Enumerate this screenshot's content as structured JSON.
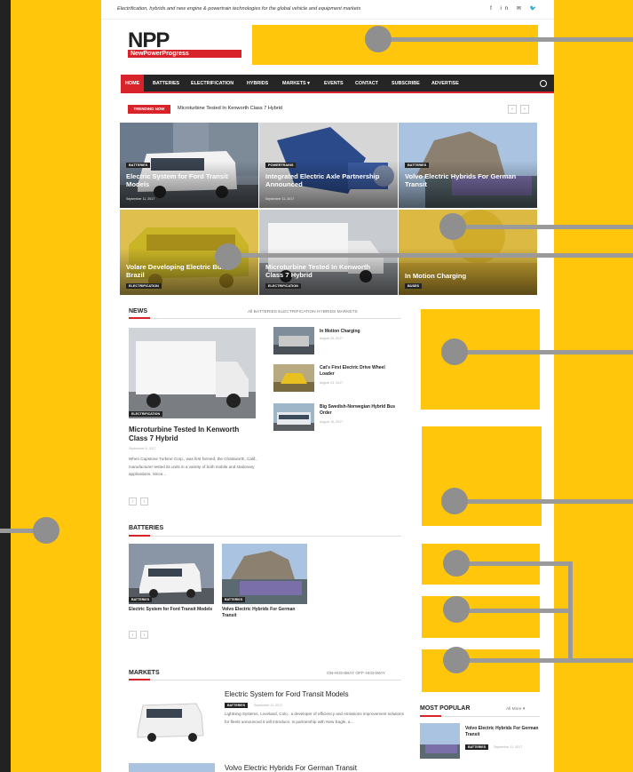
{
  "header": {
    "tagline": "Electrification, hybrids and new engine & powertrain technologies for the global vehicle and equipment markets",
    "social_icons": [
      "f",
      "in",
      "✉",
      "🐦"
    ],
    "logo_text": "NPP",
    "logo_subtext": "NewPowerProgress"
  },
  "nav": {
    "items": [
      "HOME",
      "BATTERIES",
      "ELECTRIFICATION",
      "HYBRIDS",
      "MARKETS ▾",
      "EVENTS",
      "CONTACT",
      "SUBSCRIBE",
      "ADVERTISE"
    ]
  },
  "trending": {
    "label": "TRENDING NOW",
    "text": "Microturbine Tested In Kenworth Class 7 Hybrid"
  },
  "featured": [
    {
      "category": "BATTERIES",
      "title": "Electric System for Ford Transit Models",
      "date": "September 11, 2017"
    },
    {
      "category": "POWERTRAINS",
      "title": "Integrated Electric Axle Partnership Announced",
      "date": "September 11, 2017"
    },
    {
      "category": "BATTERIES",
      "title": "Volvo Electric Hybrids For German Transit",
      "date": ""
    },
    {
      "category": "ELECTRIFICATION",
      "title": "Volare Developing Electric Bus In Brazil",
      "date": ""
    },
    {
      "category": "ELECTRIFICATION",
      "title": "Microturbine Tested In Kenworth Class 7 Hybrid",
      "date": ""
    },
    {
      "category": "BUSES",
      "title": "In Motion Charging",
      "date": ""
    }
  ],
  "news": {
    "title": "NEWS",
    "filters": "All    BATTERIES    ELECTRIFICATION    HYBRIDS    MARKETS",
    "main": {
      "category": "ELECTRIFICATION",
      "title": "Microturbine Tested In Kenworth Class 7 Hybrid",
      "date": "September 6, 2017",
      "excerpt": "When Capstone Turbine Corp., was first formed, the Chatsworth, Calif., manufacturer tested its units in a variety of both mobile and stationary applications. Since..."
    },
    "side_items": [
      {
        "title": "In Motion Charging",
        "date": "August 25, 2017"
      },
      {
        "title": "Cat's First Electric Drive Wheel Loader",
        "date": "August 23, 2017"
      },
      {
        "title": "Big Swedish-Norwegian Hybrid Bus Order",
        "date": "August 15, 2017"
      }
    ]
  },
  "batteries": {
    "title": "BATTERIES",
    "items": [
      {
        "category": "BATTERIES",
        "title": "Electric System for Ford Transit Models"
      },
      {
        "category": "BATTERIES",
        "title": "Volvo Electric Hybrids For German Transit"
      }
    ]
  },
  "markets": {
    "title": "MARKETS",
    "filters": "ON-HIGHWAY    OFF-HIGHWAY",
    "items": [
      {
        "title": "Electric System for Ford Transit Models",
        "category": "BATTERIES",
        "date": "September 11, 2017",
        "excerpt": "Lightning Systems, Loveland, Colo., a developer of efficiency and emissions improvement solutions for fleets announced it will introduce, in partnership with New Eagle, a..."
      },
      {
        "title": "Volvo Electric Hybrids For German Transit"
      }
    ]
  },
  "most_popular": {
    "title": "MOST POPULAR",
    "filters": "All    More ▾",
    "item": {
      "title": "Volvo Electric Hybrids For German Transit",
      "category": "BATTERIES",
      "date": "September 11, 2017"
    }
  },
  "pager": {
    "prev": "‹",
    "next": "›"
  },
  "colors": {
    "accent": "#d8232a",
    "highlight": "#ffc60b",
    "background": "#222222",
    "callout": "#8f8f8f"
  }
}
